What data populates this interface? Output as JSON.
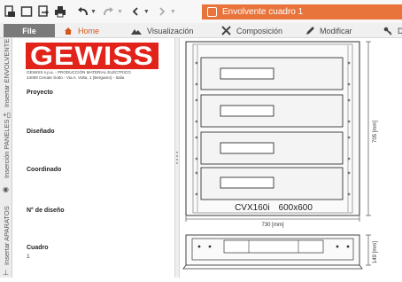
{
  "toolbar": {
    "icons": [
      "print-preview-icon",
      "new-document-icon",
      "export-icon",
      "print-icon",
      "undo-icon",
      "redo-icon",
      "back-icon",
      "forward-icon"
    ]
  },
  "document": {
    "title": "Envolvente cuadro 1"
  },
  "ribbon": {
    "file_label": "File",
    "tabs": [
      {
        "label": "Home",
        "icon": "home-icon",
        "active": true
      },
      {
        "label": "Visualización",
        "icon": "mountain-icon",
        "active": false
      },
      {
        "label": "Composición",
        "icon": "tools-icon",
        "active": false
      },
      {
        "label": "Modificar",
        "icon": "pencil-icon",
        "active": false
      },
      {
        "label": "D",
        "icon": "key-icon",
        "active": false
      }
    ]
  },
  "sidebar": {
    "labels": [
      "Insertar ENVOLVENTE",
      "Inserción PANELES",
      "Insertar APARATOS"
    ]
  },
  "panel": {
    "logo_text": "GEWISS",
    "company_line1": "GEWISS s.p.a. - PRODUCCIÓN MATERIAL ELÉCTRICO",
    "company_line2": "24069 Cenate Sotto - Via A. Volta, 1 (Bergamo) - Italia",
    "fields": [
      {
        "label": "Proyecto",
        "value": ""
      },
      {
        "label": "Diseñado",
        "value": ""
      },
      {
        "label": "Coordinado",
        "value": ""
      },
      {
        "label": "N° de diseño",
        "value": ""
      },
      {
        "label": "Cuadro",
        "value": "1"
      }
    ]
  },
  "drawing": {
    "model_label": "CVX160i",
    "size_label": "600x600",
    "width_dim": "730 [mm]",
    "height_dim": "705 [mm]",
    "depth_dim": "149 [mm]"
  },
  "colors": {
    "accent": "#e8743b",
    "brand_red": "#e2231a"
  }
}
